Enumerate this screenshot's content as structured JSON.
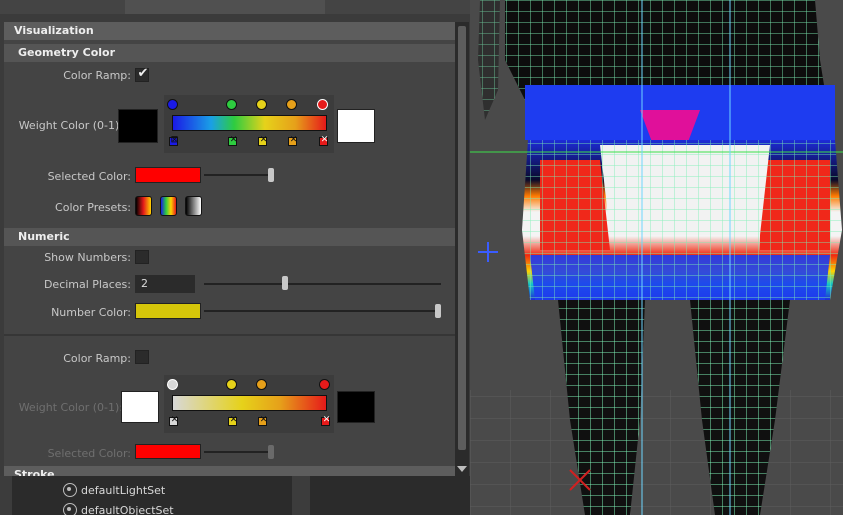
{
  "sections": {
    "visualization": "Visualization",
    "geometry_color": "Geometry Color",
    "numeric": "Numeric",
    "stroke": "Stroke"
  },
  "geometry_color": {
    "color_ramp_label": "Color Ramp:",
    "color_ramp_checked": true,
    "weight_color_label": "Weight Color (0-1):",
    "low_color": "#000000",
    "high_color": "#ffffff",
    "ramp_keys": [
      "#1a1ae6",
      "#2ecc40",
      "#e6d21a",
      "#e6a01a",
      "#e61a1a"
    ],
    "selected_color_label": "Selected Color:",
    "selected_color": "#ff0000",
    "color_presets_label": "Color Presets:"
  },
  "numeric": {
    "show_numbers_label": "Show Numbers:",
    "show_numbers_checked": false,
    "decimal_places_label": "Decimal Places:",
    "decimal_places_value": "2",
    "number_color_label": "Number Color:",
    "number_color": "#d6c60a"
  },
  "second_ramp": {
    "color_ramp_label": "Color Ramp:",
    "color_ramp_checked": false,
    "weight_color_label": "Weight Color (0-1):",
    "low_color": "#ffffff",
    "high_color": "#000000",
    "ramp_keys": [
      "#d8d8d8",
      "#e6d21a",
      "#e6a01a",
      "#e61a1a"
    ],
    "selected_color_label": "Selected Color:",
    "selected_color": "#ff0000"
  },
  "outliner": {
    "items": [
      "defaultLightSet",
      "defaultObjectSet"
    ]
  }
}
